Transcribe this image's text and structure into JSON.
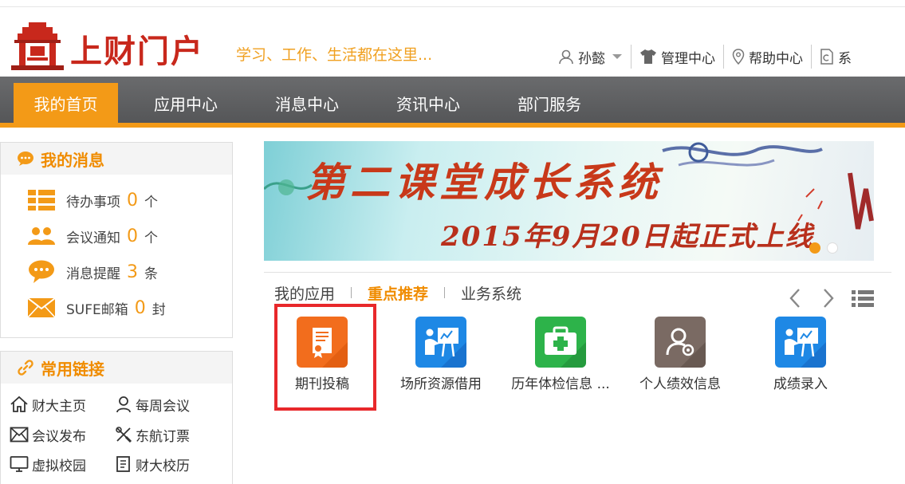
{
  "header": {
    "logo_text": "上财门户",
    "slogan": "学习、工作、生活都在这里..."
  },
  "userbar": {
    "user_name": "孙懿",
    "admin_center": "管理中心",
    "help_center": "帮助中心",
    "system": "系"
  },
  "nav": {
    "items": [
      "我的首页",
      "应用中心",
      "消息中心",
      "资讯中心",
      "部门服务"
    ],
    "active_index": 0
  },
  "my_messages": {
    "title": "我的消息",
    "rows": [
      {
        "label": "待办事项",
        "count": "0",
        "unit": "个"
      },
      {
        "label": "会议通知",
        "count": "0",
        "unit": "个"
      },
      {
        "label": "消息提醒",
        "count": "3",
        "unit": "条"
      },
      {
        "label": "SUFE邮箱",
        "count": "0",
        "unit": "封"
      }
    ]
  },
  "common_links": {
    "title": "常用链接",
    "items": [
      "财大主页",
      "每周会议",
      "会议发布",
      "东航订票",
      "虚拟校园",
      "财大校历"
    ]
  },
  "banner": {
    "title": "第二课堂成长系统",
    "subtitle": "2015年9月20日起正式上线"
  },
  "app_tabs": {
    "items": [
      "我的应用",
      "重点推荐",
      "业务系统"
    ],
    "active_index": 1
  },
  "apps": [
    {
      "label": "期刊投稿",
      "icon": "certificate-icon",
      "color": "#f26d1d"
    },
    {
      "label": "场所资源借用",
      "icon": "presentation-icon",
      "color": "#1e88e5"
    },
    {
      "label": "历年体检信息 ...",
      "icon": "medical-kit-icon",
      "color": "#2db34a"
    },
    {
      "label": "个人绩效信息",
      "icon": "user-settings-icon",
      "color": "#7a6a63"
    },
    {
      "label": "成绩录入",
      "icon": "presentation-icon",
      "color": "#1e88e5"
    }
  ],
  "colors": {
    "accent": "#f39a17",
    "nav_bg": "#5e5f61",
    "brand_red": "#c8281c",
    "highlight": "#e8282b"
  }
}
